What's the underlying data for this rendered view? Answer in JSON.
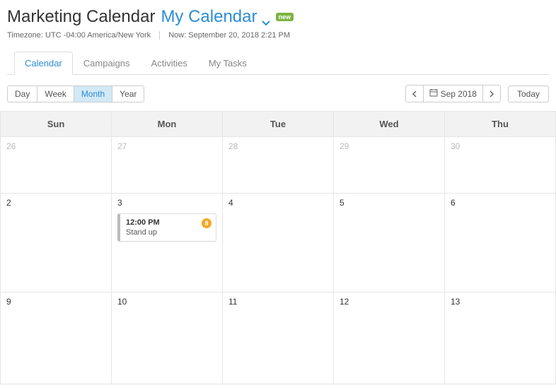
{
  "header": {
    "title_main": "Marketing Calendar",
    "title_sub": "My Calendar",
    "badge": "new",
    "timezone": "Timezone: UTC -04:00 America/New York",
    "now": "Now: September 20, 2018 2:21 PM"
  },
  "tabs": [
    {
      "label": "Calendar",
      "active": true
    },
    {
      "label": "Campaigns",
      "active": false
    },
    {
      "label": "Activities",
      "active": false
    },
    {
      "label": "My Tasks",
      "active": false
    }
  ],
  "view_buttons": [
    {
      "label": "Day",
      "active": false
    },
    {
      "label": "Week",
      "active": false
    },
    {
      "label": "Month",
      "active": true
    },
    {
      "label": "Year",
      "active": false
    }
  ],
  "nav": {
    "period": "Sep 2018",
    "today": "Today"
  },
  "day_headers": [
    "Sun",
    "Mon",
    "Tue",
    "Wed",
    "Thu"
  ],
  "weeks": [
    {
      "cls": "week-first",
      "cells": [
        {
          "num": "26",
          "other": true
        },
        {
          "num": "27",
          "other": true
        },
        {
          "num": "28",
          "other": true
        },
        {
          "num": "29",
          "other": true
        },
        {
          "num": "30",
          "other": true
        }
      ]
    },
    {
      "cls": "week-mid",
      "cells": [
        {
          "num": "2",
          "other": false
        },
        {
          "num": "3",
          "other": false,
          "event": {
            "time": "12:00 PM",
            "title": "Stand up",
            "count": "8"
          }
        },
        {
          "num": "4",
          "other": false
        },
        {
          "num": "5",
          "other": false
        },
        {
          "num": "6",
          "other": false
        }
      ]
    },
    {
      "cls": "week-last",
      "cells": [
        {
          "num": "9",
          "other": false
        },
        {
          "num": "10",
          "other": false
        },
        {
          "num": "11",
          "other": false
        },
        {
          "num": "12",
          "other": false
        },
        {
          "num": "13",
          "other": false
        }
      ]
    }
  ]
}
